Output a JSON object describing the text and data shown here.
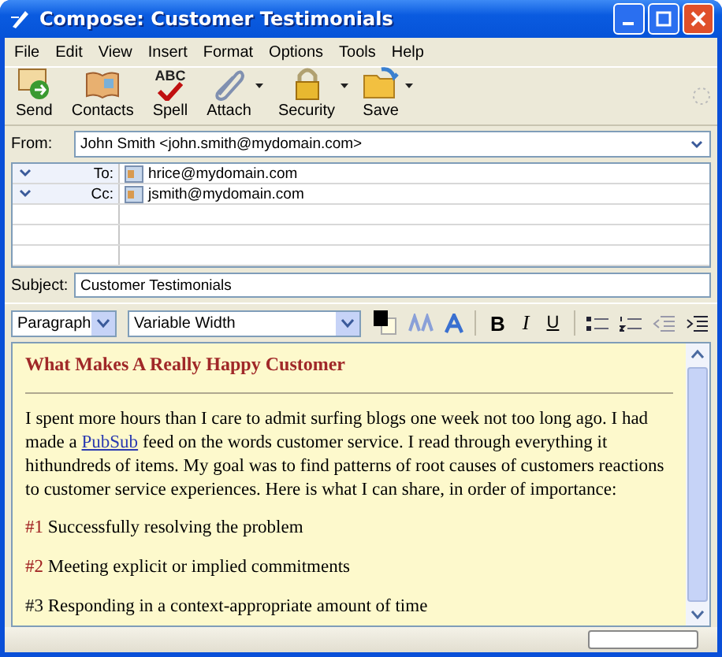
{
  "window": {
    "title": "Compose: Customer Testimonials"
  },
  "menu": [
    "File",
    "Edit",
    "View",
    "Insert",
    "Format",
    "Options",
    "Tools",
    "Help"
  ],
  "toolbar": [
    {
      "label": "Send",
      "kind": "send",
      "dropdown": false
    },
    {
      "label": "Contacts",
      "kind": "contacts",
      "dropdown": false
    },
    {
      "label": "Spell",
      "kind": "spell",
      "dropdown": false,
      "icon_text": "ABC"
    },
    {
      "label": "Attach",
      "kind": "attach",
      "dropdown": true
    },
    {
      "label": "Security",
      "kind": "security",
      "dropdown": true
    },
    {
      "label": "Save",
      "kind": "save",
      "dropdown": true
    }
  ],
  "from": {
    "label": "From:",
    "value": "John Smith <john.smith@mydomain.com>"
  },
  "recipients": [
    {
      "type": "To:",
      "address": "hrice@mydomain.com"
    },
    {
      "type": "Cc:",
      "address": "jsmith@mydomain.com"
    }
  ],
  "subject": {
    "label": "Subject:",
    "value": "Customer Testimonials"
  },
  "format_bar": {
    "paragraph": "Paragraph",
    "font": "Variable Width",
    "bold": "B",
    "italic": "I",
    "underline": "U"
  },
  "body": {
    "heading": "What Makes A Really Happy Customer",
    "paragraph": {
      "before": "I spent more hours than I care to admit surfing blogs one week not too long ago. I had made a ",
      "link": "PubSub",
      "after": " feed on the words customer service. I read through everything it hithundreds of items. My goal was to find patterns of root causes of customers reactions to customer service experiences. Here is what I can share, in order of importance:"
    },
    "items": [
      {
        "number": "#1",
        "text": "Successfully resolving the problem",
        "color": "#a02020"
      },
      {
        "number": "#2",
        "text": "Meeting explicit or implied commitments",
        "color": "#a02020"
      },
      {
        "number": "#3",
        "text": "Responding in a context-appropriate amount of time",
        "color": "#111111"
      }
    ]
  }
}
